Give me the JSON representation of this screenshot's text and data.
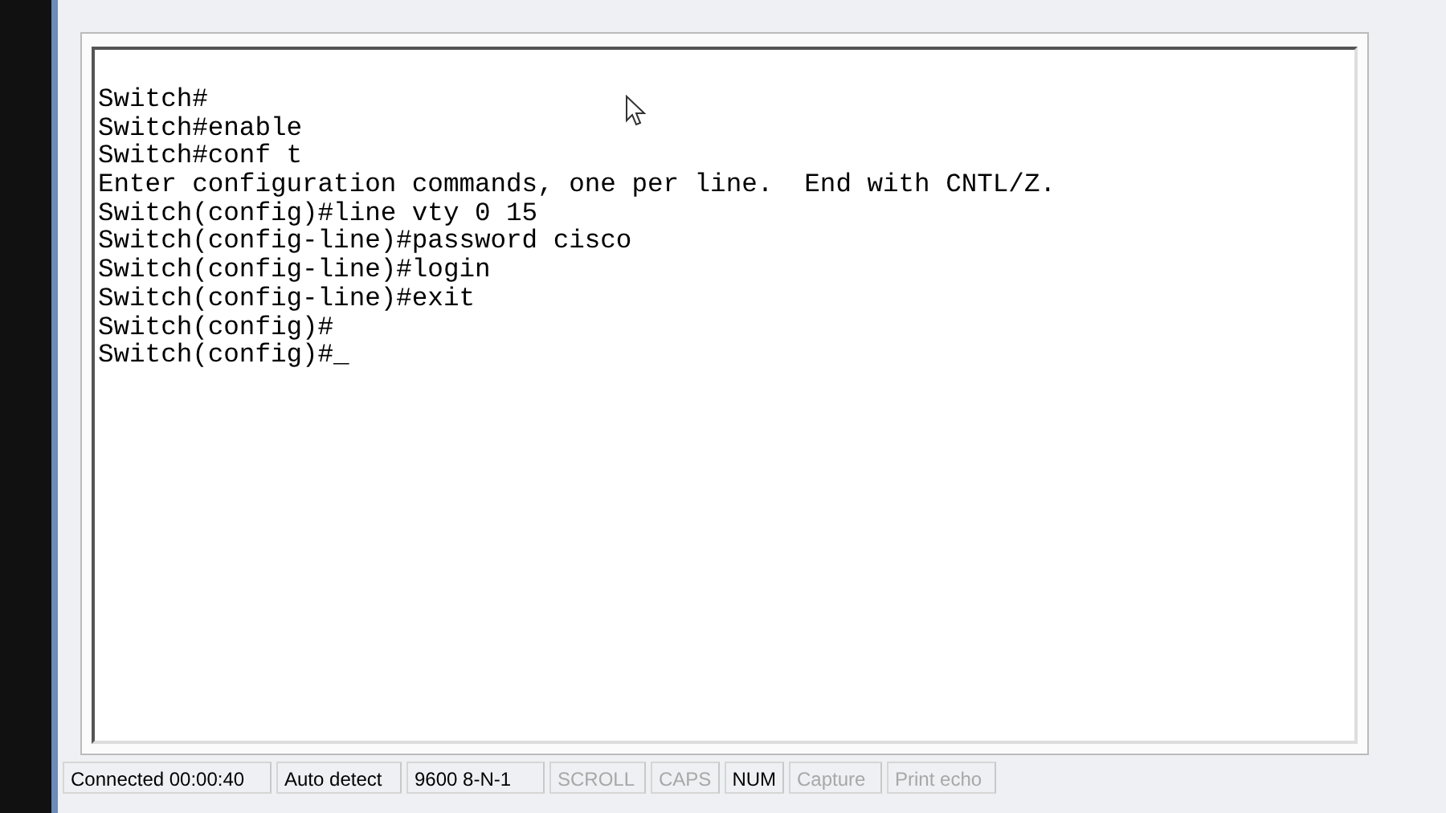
{
  "terminal": {
    "lines": [
      "Switch#",
      "Switch#enable",
      "Switch#conf t",
      "Enter configuration commands, one per line.  End with CNTL/Z.",
      "Switch(config)#line vty 0 15",
      "Switch(config-line)#password cisco",
      "Switch(config-line)#login",
      "Switch(config-line)#exit",
      "Switch(config)#",
      "Switch(config)#_"
    ]
  },
  "status_bar": [
    {
      "text": "Connected 00:00:40",
      "disabled": false
    },
    {
      "text": "Auto detect",
      "disabled": false
    },
    {
      "text": "9600 8-N-1",
      "disabled": false
    },
    {
      "text": "SCROLL",
      "disabled": true
    },
    {
      "text": "CAPS",
      "disabled": true
    },
    {
      "text": "NUM",
      "disabled": false
    },
    {
      "text": "Capture",
      "disabled": true
    },
    {
      "text": "Print echo",
      "disabled": true
    }
  ]
}
